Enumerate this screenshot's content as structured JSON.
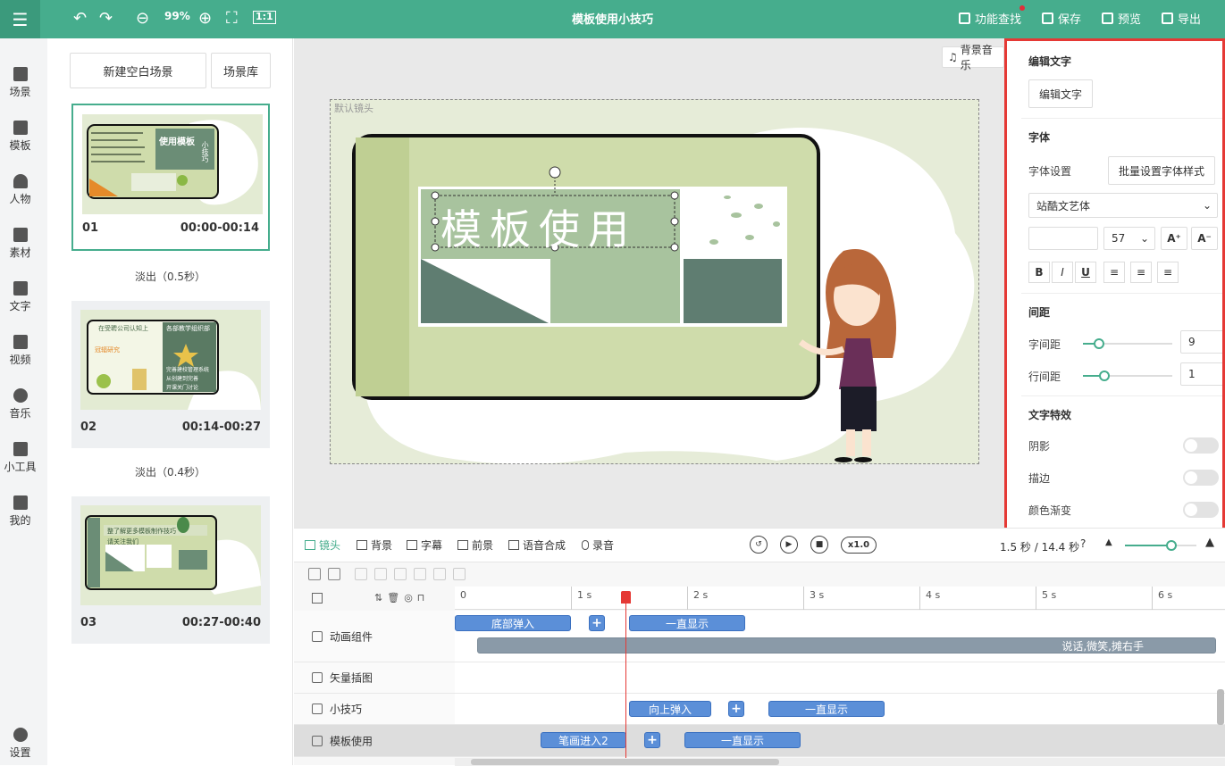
{
  "header": {
    "title": "模板使用小技巧",
    "zoom": "99%",
    "zoom_out_icon": "minus-circle-icon",
    "zoom_in_icon": "plus-circle-icon",
    "actions": {
      "search": "功能查找",
      "save": "保存",
      "preview": "预览",
      "export": "导出"
    }
  },
  "nav": {
    "items": [
      {
        "label": "场景",
        "icon": "scene-icon"
      },
      {
        "label": "模板",
        "icon": "template-icon"
      },
      {
        "label": "人物",
        "icon": "person-icon"
      },
      {
        "label": "素材",
        "icon": "material-icon"
      },
      {
        "label": "文字",
        "icon": "text-icon"
      },
      {
        "label": "视频",
        "icon": "video-icon"
      },
      {
        "label": "音乐",
        "icon": "music-icon"
      },
      {
        "label": "小工具",
        "icon": "toolbox-icon"
      },
      {
        "label": "我的",
        "icon": "upload-icon"
      }
    ],
    "settings": "设置"
  },
  "scenes": {
    "new_blank": "新建空白场景",
    "library": "场景库",
    "items": [
      {
        "num": "01",
        "time": "00:00-00:14"
      },
      {
        "num": "02",
        "time": "00:14-00:27"
      },
      {
        "num": "03",
        "time": "00:27-00:40"
      }
    ],
    "transitions": [
      "淡出（0.5秒）",
      "淡出（0.4秒）"
    ],
    "thumb_texts": {
      "t1_title": "使用模板",
      "t1_side": "小技巧",
      "t2_top": "在受聘公司认知上",
      "t2_right": "各部教学组织部",
      "t2_left": "冠辐研究",
      "t2_lines": [
        "完善建校管理系统",
        "从创建到完善",
        "开课关门讨论"
      ],
      "t3_banner": "整了解更多模板制作技巧",
      "t3_sub": "请关注我们"
    }
  },
  "stage": {
    "bgm_label": "背景音乐",
    "camera_label": "默认镜头",
    "headline": "模板使用"
  },
  "props": {
    "edit_text_head": "编辑文字",
    "edit_text_btn": "编辑文字",
    "font_head": "字体",
    "font_setting": "字体设置",
    "batch_btn": "批量设置字体样式",
    "font_family": "站酷文艺体",
    "font_size": "57",
    "size_up": "A⁺",
    "size_down": "A⁻",
    "format": [
      "B",
      "I",
      "U"
    ],
    "align_icons": [
      "align-left-icon",
      "align-center-icon",
      "align-right-icon"
    ],
    "spacing_head": "间距",
    "letter_spacing_label": "字间距",
    "letter_spacing": "9",
    "line_spacing_label": "行间距",
    "line_spacing": "1",
    "effects_head": "文字特效",
    "shadow": "阴影",
    "stroke": "描边",
    "gradient": "颜色渐变"
  },
  "tools": {
    "tabs": [
      "镜头",
      "背景",
      "字幕",
      "前景",
      "语音合成",
      "录音"
    ],
    "speed": "x1.0",
    "time_readout": "1.5 秒 / 14.4 秒"
  },
  "timeline": {
    "ticks": [
      "0",
      "1 s",
      "2 s",
      "3 s",
      "4 s",
      "5 s",
      "6 s"
    ],
    "tracks": [
      {
        "label": "动画组件"
      },
      {
        "label": "矢量插图"
      },
      {
        "label": "小技巧"
      },
      {
        "label": "模板使用"
      }
    ],
    "clips": {
      "c1": "底部弹入",
      "c2": "一直显示",
      "c3": "说话,微笑,摊右手",
      "c4": "向上弹入",
      "c5": "一直显示",
      "c6": "笔画进入2",
      "c7": "一直显示"
    }
  }
}
